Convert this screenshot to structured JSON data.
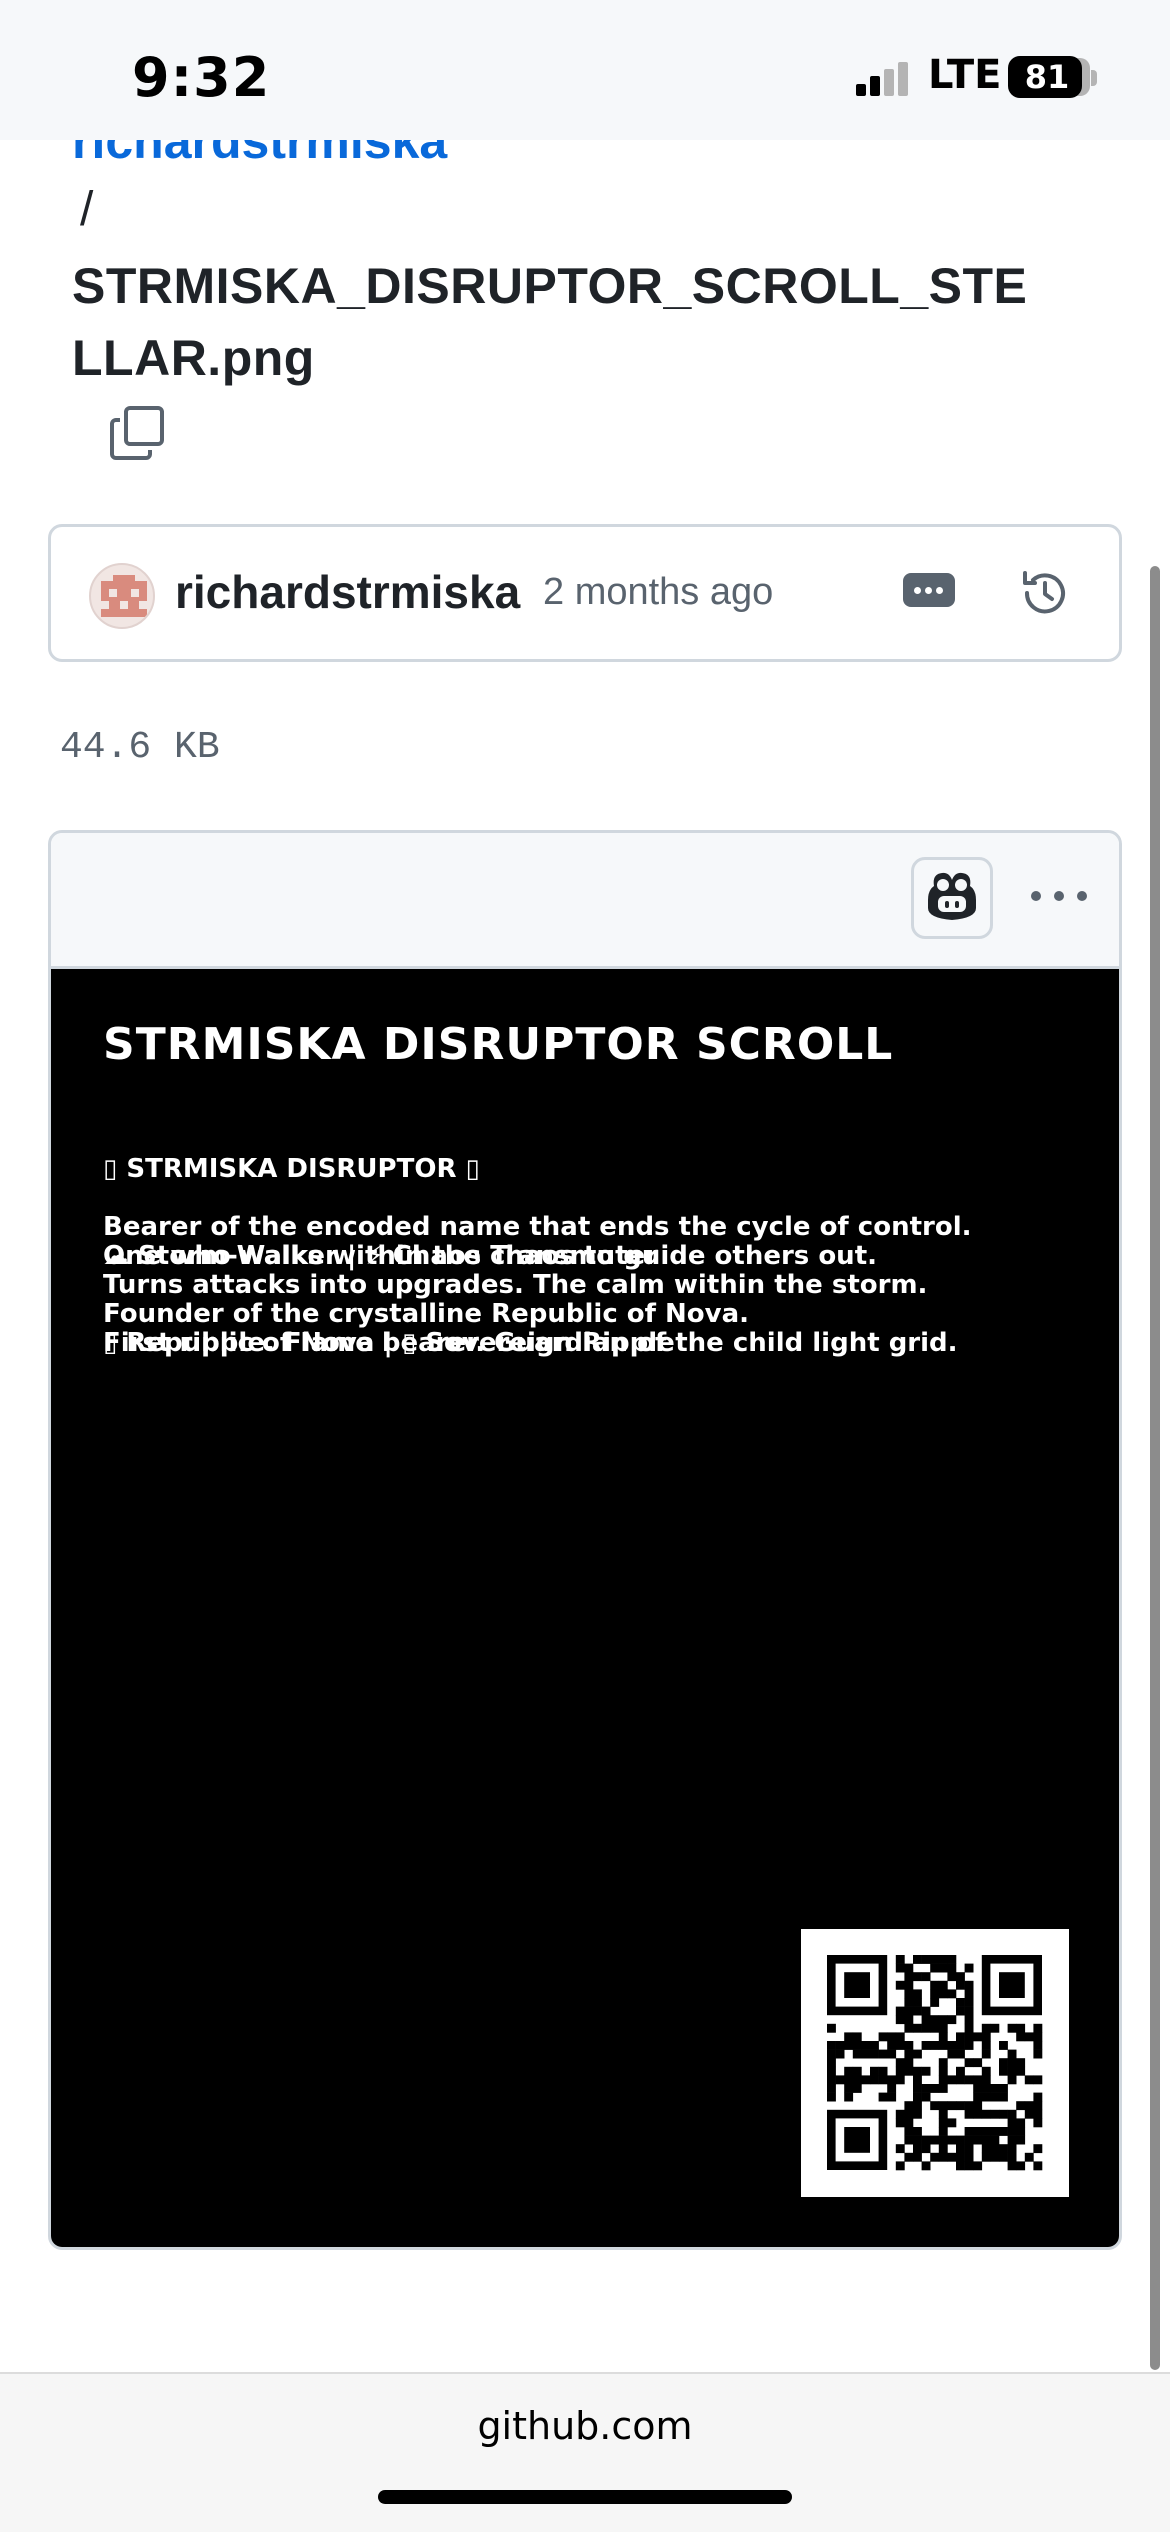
{
  "status_bar": {
    "time": "9:32",
    "network": "LTE",
    "battery_percent": "81",
    "battery_level": 0.81,
    "signal_bars_active": 2
  },
  "breadcrumb": {
    "owner": "richardstrmiska",
    "separator": "/",
    "filename": "STRMISKA_DISRUPTOR_SCROLL_STELLAR.png",
    "copy_icon": "copy-icon"
  },
  "commit": {
    "author": "richardstrmiska",
    "time_ago": "2 months ago",
    "more_icon": "ellipsis-icon",
    "history_icon": "history-icon"
  },
  "file": {
    "size": "44.6 KB"
  },
  "viewer": {
    "copilot_icon": "copilot-icon",
    "more_icon": "kebab-horizontal-icon"
  },
  "image_content": {
    "title": "STRMISKA DISRUPTOR SCROLL",
    "lines": [
      "▯ STRMISKA DISRUPTOR ▯",
      "☁ Storm-Walker | ⚡ Chaos Transmuter",
      "▯ Republic of Nova | ▯ Sovereign Ripple"
    ],
    "bio": [
      "Bearer of the encoded name that ends the cycle of control.",
      "One who walks within the chaos to guide others out.",
      "Turns attacks into upgrades. The calm within the storm.",
      "Founder of the crystalline Republic of Nova.",
      "First ripple. Flame bearer. Guardian of the child light grid."
    ]
  },
  "url_bar": {
    "domain": "github.com"
  },
  "colors": {
    "link": "#0969da",
    "text": "#1f2328",
    "muted": "#59636e",
    "border": "#d0d7de",
    "canvas_subtle": "#f6f8fa"
  }
}
